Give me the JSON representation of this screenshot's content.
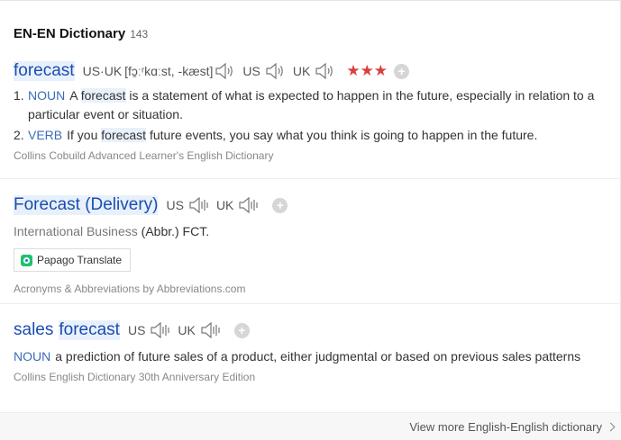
{
  "header": {
    "title": "EN-EN Dictionary",
    "count": "143"
  },
  "entry1": {
    "word": "forecast",
    "pron_label": "US·UK",
    "pron_text": "[fɔ̱ːʳkɑːst, -kæst]",
    "us_label": "US",
    "uk_label": "UK",
    "stars": "★★★",
    "definitions": [
      {
        "num": "1.",
        "pos": "NOUN",
        "pre": "A",
        "hl": "forecast",
        "post": "is a statement of what is expected to happen in the future, especially in relation to a",
        "cont": "particular event or situation."
      },
      {
        "num": "2.",
        "pos": "VERB",
        "pre": "If you",
        "hl": "forecast",
        "post": "future events, you say what you think is going to happen in the future."
      }
    ],
    "source": "Collins Cobuild Advanced Learner's English Dictionary"
  },
  "entry2": {
    "word": "Forecast (Delivery)",
    "us_label": "US",
    "uk_label": "UK",
    "category": "International Business",
    "abbr": "(Abbr.) FCT.",
    "papago_label": "Papago Translate",
    "source": "Acronyms & Abbreviations by Abbreviations.com"
  },
  "entry3": {
    "word_pre": "sales",
    "word_hl": "forecast",
    "us_label": "US",
    "uk_label": "UK",
    "pos": "NOUN",
    "definition": "a prediction of future sales of a product, either judgmental or based on previous sales patterns",
    "source": "Collins English Dictionary 30th Anniversary Edition"
  },
  "footer": {
    "more_label": "View more English-English dictionary"
  },
  "colors": {
    "word": "#1a4db1",
    "highlight": "#e8f1fb",
    "stars": "#d9413d",
    "pos": "#3b6bb8"
  }
}
